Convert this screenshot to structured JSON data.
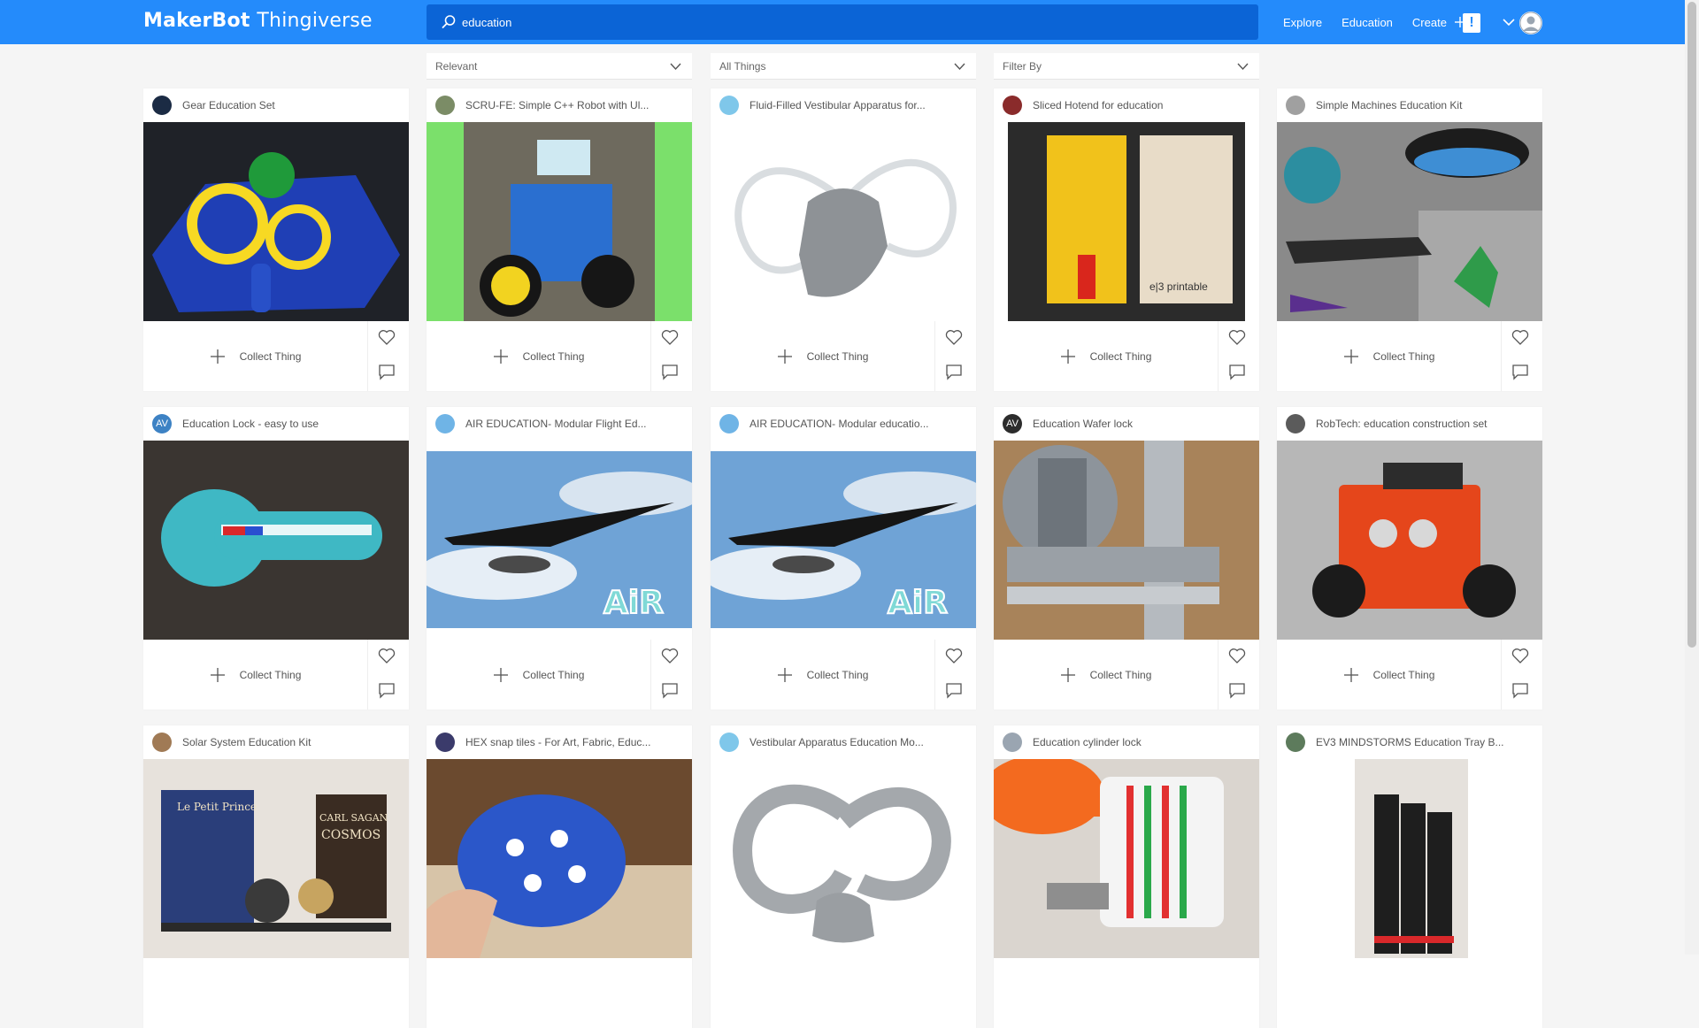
{
  "header": {
    "logo_bold": "MakerBot",
    "logo_light": "Thingiverse",
    "search_value": "education",
    "nav": {
      "explore": "Explore",
      "education": "Education",
      "create": "Create"
    },
    "alert": "!"
  },
  "filters": {
    "sort": "Relevant",
    "type": "All Things",
    "filter": "Filter By"
  },
  "collect_label": "Collect Thing",
  "cards": [
    {
      "title": "Gear Education Set"
    },
    {
      "title": "SCRU-FE: Simple C++ Robot with Ul..."
    },
    {
      "title": "Fluid-Filled Vestibular Apparatus for..."
    },
    {
      "title": "Sliced Hotend for education"
    },
    {
      "title": "Simple Machines Education Kit"
    },
    {
      "title": "Education Lock - easy to use",
      "avatar_text": "AV"
    },
    {
      "title": "AIR EDUCATION- Modular Flight Ed..."
    },
    {
      "title": "AIR EDUCATION- Modular educatio..."
    },
    {
      "title": "Education Wafer lock",
      "avatar_text": "AV"
    },
    {
      "title": "RobTech: education construction set"
    },
    {
      "title": "Solar System Education Kit"
    },
    {
      "title": "HEX snap tiles - For Art, Fabric, Educ..."
    },
    {
      "title": "Vestibular Apparatus Education Mo..."
    },
    {
      "title": "Education cylinder lock"
    },
    {
      "title": "EV3 MINDSTORMS Education Tray B..."
    }
  ],
  "thumb_text": {
    "hotend_brand": "e|3 printable",
    "air_logo": "AiR",
    "book1": "Le Petit Prince",
    "book2_line1": "CARL SAGAN",
    "book2_line2": "COSMOS"
  },
  "colors": {
    "header_blue": "#248bfb",
    "search_blue": "#0b64d6"
  }
}
